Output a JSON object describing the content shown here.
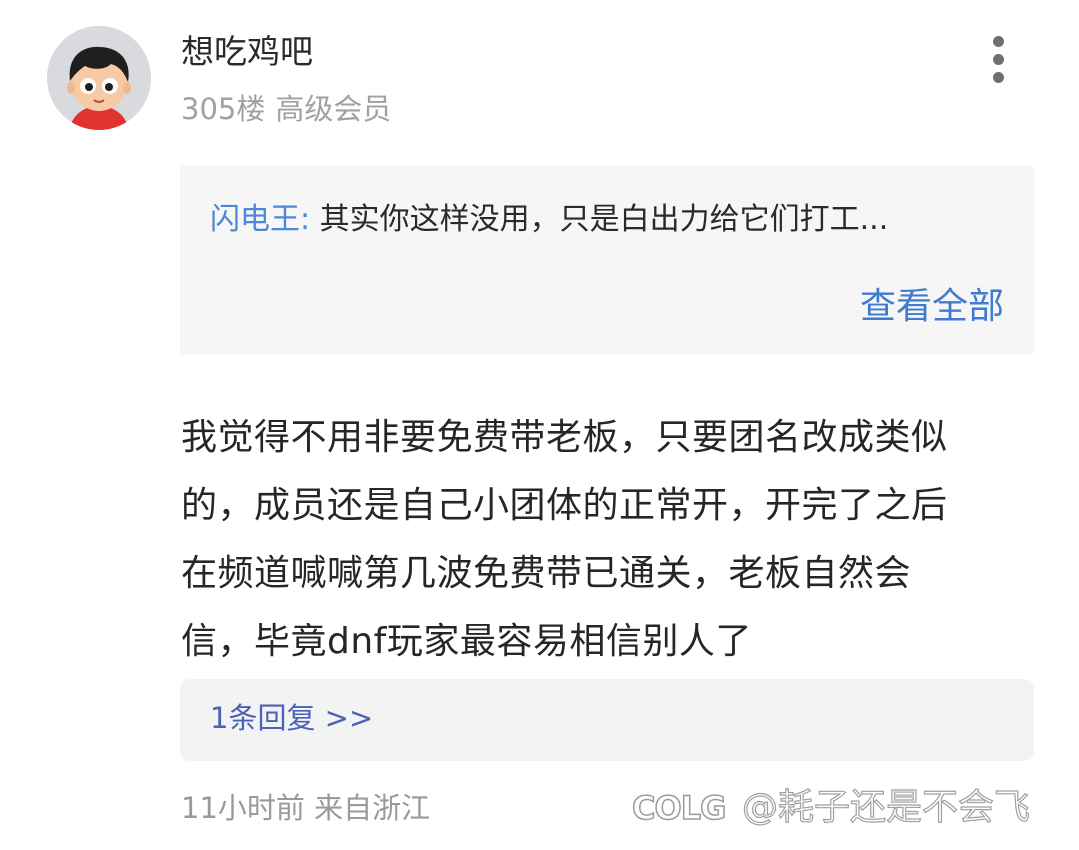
{
  "comment": {
    "username": "想吃鸡吧",
    "floor": "305楼",
    "member_level": "高级会员",
    "more_icon": "more-vertical-icon",
    "avatar_icon": "cartoon-boy-avatar",
    "quote": {
      "author": "闪电王:",
      "text": " 其实你这样没用，只是白出力给它们打工...",
      "view_all_label": "查看全部"
    },
    "body_lines": [
      "我觉得不用非要免费带老板，只要团名改成类似",
      "的，成员还是自己小团体的正常开，开完了之后",
      "在频道喊喊第几波免费带已通关，老板自然会",
      "信，毕竟dnf玩家最容易相信别人了"
    ],
    "replies_label": "1条回复 >>",
    "time_location": "11小时前 来自浙江"
  },
  "watermark": {
    "logo": "COLG",
    "handle": "@耗子还是不会飞"
  },
  "colors": {
    "link_blue": "#3f7bd1",
    "quote_author_blue": "#4c87d6",
    "replies_blue": "#4a62b8",
    "quote_bg": "#f6f6f7",
    "meta_gray": "#a1a1a1"
  }
}
